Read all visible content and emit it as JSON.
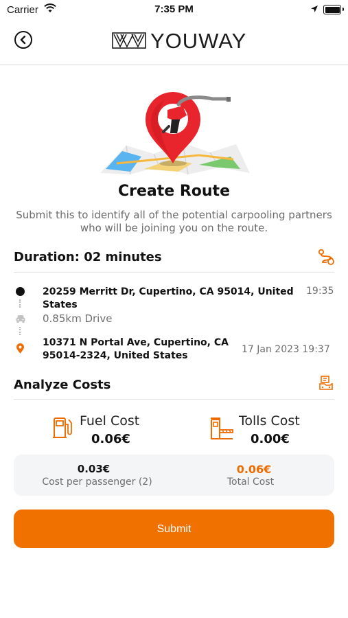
{
  "status_bar": {
    "carrier": "Carrier",
    "time": "7:35 PM"
  },
  "header": {
    "brand": "YOUWAY"
  },
  "main": {
    "title": "Create Route",
    "description": "Submit this to identify all of the potential carpooling partners who will be joining you on the route."
  },
  "duration": {
    "label": "Duration: 02 minutes"
  },
  "route": {
    "origin": {
      "address": "20259 Merritt Dr, Cupertino, CA 95014, United States",
      "time": "19:35"
    },
    "drive": "0.85km Drive",
    "destination": {
      "address_line1": "10371 N Portal Ave, Cupertino, CA",
      "address_line2": "95014-2324, United States",
      "time": "17 Jan 2023 19:37"
    }
  },
  "costs": {
    "title": "Analyze Costs",
    "fuel": {
      "label": "Fuel Cost",
      "value": "0.06€"
    },
    "tolls": {
      "label": "Tolls Cost",
      "value": "0.00€"
    },
    "per_passenger": {
      "value": "0.03€",
      "label": "Cost per passenger (2)"
    },
    "total": {
      "value": "0.06€",
      "label": "Total Cost"
    }
  },
  "submit_label": "Submit",
  "colors": {
    "accent": "#F07100",
    "pin_red": "#E8242C",
    "text": "#111111",
    "muted": "#6F6F6F",
    "panel": "#F3F5F6"
  },
  "icons": [
    "back-icon",
    "wifi-icon",
    "location-arrow-icon",
    "battery-icon",
    "route-icon",
    "car-icon",
    "map-pin-icon",
    "money-icon",
    "fuel-pump-icon",
    "toll-booth-icon"
  ]
}
